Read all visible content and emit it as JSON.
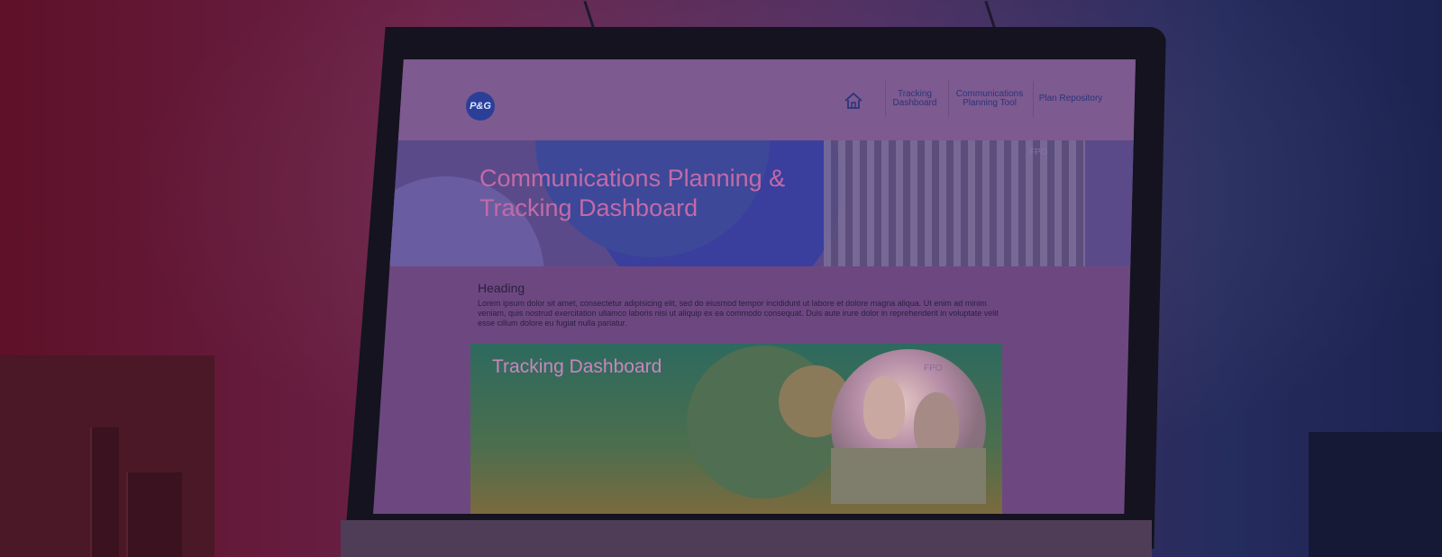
{
  "site": {
    "logo_text": "P&G",
    "nav": {
      "home_icon": "home-icon",
      "items": [
        {
          "label": "Tracking Dashboard"
        },
        {
          "label": "Communications Planning Tool"
        },
        {
          "label": "Plan Repository"
        }
      ]
    },
    "hero": {
      "title": "Communications Planning & Tracking Dashboard",
      "fpo": "FPO"
    },
    "content": {
      "heading": "Heading",
      "paragraph": "Lorem ipsum dolor sit amet, consectetur adipisicing elit, sed do eiusmod tempor incididunt ut labore et dolore magna aliqua. Ut enim ad minim veniam, quis nostrud exercitation ullamco laboris nisi ut aliquip ex ea commodo consequat. Duis aute irure dolor in reprehenderit in voluptate velit esse cillum dolore eu fugiat nulla pariatur."
    },
    "card": {
      "title": "Tracking Dashboard",
      "fpo": "FPO"
    }
  },
  "colors": {
    "overlay_left": "#5e1128",
    "overlay_right": "#1d2350",
    "brand_blue": "#2b3f98",
    "hero_title": "#c36aa8"
  }
}
